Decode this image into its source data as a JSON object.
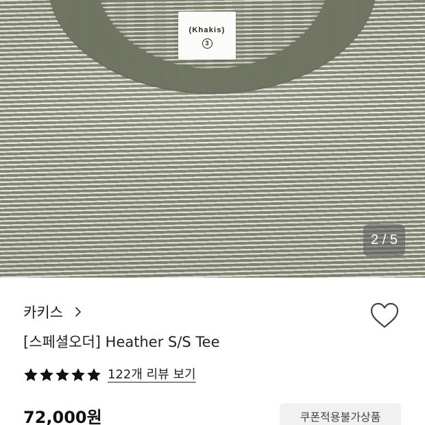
{
  "gallery": {
    "label_brand": "(Khakis)",
    "label_size": "3",
    "counter": "2 / 5"
  },
  "product": {
    "brand": "카키스",
    "title": "[스페셜오더] Heather S/S Tee",
    "rating": 5,
    "rating_max": 5,
    "review_link": "122개 리뷰 보기",
    "price": "72,000원",
    "coupon_badge": "쿠폰적용불가상품"
  },
  "icons": {
    "brand_chevron": "chevron-right-icon",
    "wishlist": "heart-outline-icon",
    "rating": "star-icon"
  },
  "colors": {
    "star": "#111111",
    "counter_bg": "#5f5f5f",
    "badge_bg": "#f1f1f1"
  }
}
